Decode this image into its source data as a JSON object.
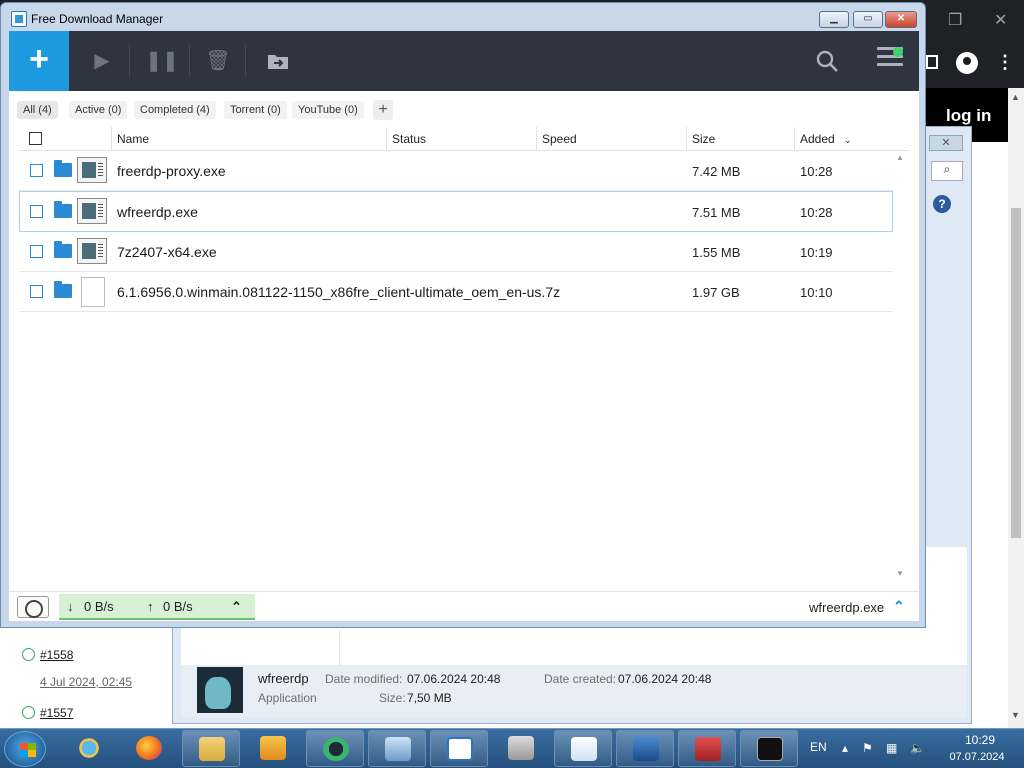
{
  "window": {
    "title": "Free Download Manager"
  },
  "toolbar": {
    "add_label": "+"
  },
  "tabs": [
    {
      "label": "All (4)"
    },
    {
      "label": "Active (0)"
    },
    {
      "label": "Completed (4)"
    },
    {
      "label": "Torrent (0)"
    },
    {
      "label": "YouTube (0)"
    }
  ],
  "columns": {
    "name": "Name",
    "status": "Status",
    "speed": "Speed",
    "size": "Size",
    "added": "Added"
  },
  "downloads": [
    {
      "name": "freerdp-proxy.exe",
      "size": "7.42 MB",
      "added": "10:28",
      "icon": "exe-file-icon"
    },
    {
      "name": "wfreerdp.exe",
      "size": "7.51 MB",
      "added": "10:28",
      "icon": "exe-file-icon"
    },
    {
      "name": "7z2407-x64.exe",
      "size": "1.55 MB",
      "added": "10:19",
      "icon": "exe-file-icon"
    },
    {
      "name": "6.1.6956.0.winmain.081122-1150_x86fre_client-ultimate_oem_en-us.7z",
      "size": "1.97 GB",
      "added": "10:10",
      "icon": "generic-file-icon"
    }
  ],
  "statusbar": {
    "down_speed": "0 B/s",
    "up_speed": "0 B/s",
    "current_file": "wfreerdp.exe"
  },
  "background": {
    "login_text": "log in",
    "history": [
      {
        "id": "#1558",
        "date": "4 Jul 2024, 02:45"
      },
      {
        "id": "#1557",
        "date": ""
      }
    ],
    "details": {
      "name": "wfreerdp",
      "type": "Application",
      "modified_label": "Date modified:",
      "modified_value": "07.06.2024 20:48",
      "created_label": "Date created:",
      "created_value": "07.06.2024 20:48",
      "size_label": "Size:",
      "size_value": "7,50 MB"
    }
  },
  "taskbar": {
    "language": "EN",
    "time": "10:29",
    "date": "07.07.2024"
  },
  "colors": {
    "accent": "#1e9be0",
    "toolbar_bg": "#2e3440",
    "speed_bar": "#d8f0d6"
  }
}
